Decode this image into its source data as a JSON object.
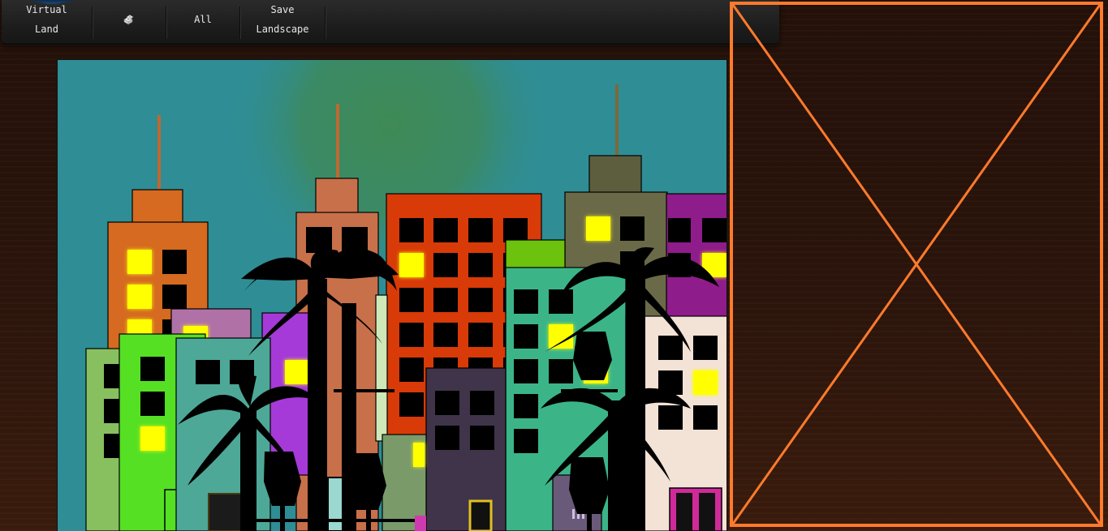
{
  "toolbar": {
    "virtual_land_line1": "Virtual",
    "virtual_land_line2": "Land",
    "randomize_icon": "dice-icon",
    "all_label": "All",
    "save_line1": "Save",
    "save_line2": "Landscape"
  },
  "colors": {
    "toolbar_bg": "#1f1f1f",
    "toolbar_text": "#e8e8e8",
    "page_bg": "#2c150b",
    "sky": "#2f8d95",
    "moon": "#3d8a5e",
    "placeholder_stroke": "#ff7a2c",
    "lit_window": "#ffff00",
    "dark_window": "#000000"
  },
  "placeholder": {
    "icon": "broken-image-x-icon"
  }
}
